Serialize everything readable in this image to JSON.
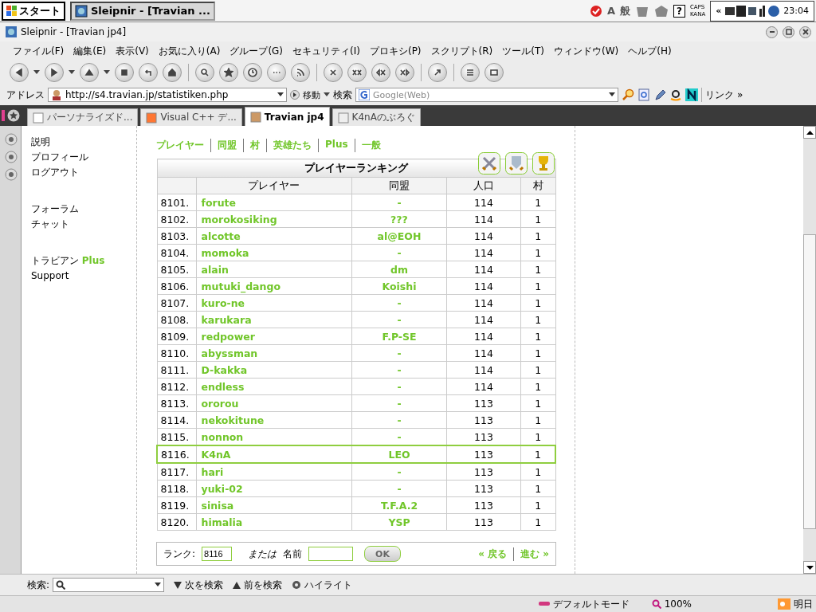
{
  "taskbar": {
    "start": "スタート",
    "tasks": [
      {
        "label": "Sleipnir - [Travian ...",
        "selected": true
      }
    ],
    "ime": [
      "A",
      "般"
    ],
    "help": "?",
    "caps": "CAPS",
    "kana": "KANA",
    "expand": "«",
    "clock": "23:04"
  },
  "window": {
    "title": "Sleipnir - [Travian jp4]"
  },
  "menu": [
    "ファイル(F)",
    "編集(E)",
    "表示(V)",
    "お気に入り(A)",
    "グループ(G)",
    "セキュリティ(I)",
    "プロキシ(P)",
    "スクリプト(R)",
    "ツール(T)",
    "ウィンドウ(W)",
    "ヘルプ(H)"
  ],
  "address_bar": {
    "label": "アドレス",
    "url": "http://s4.travian.jp/statistiken.php",
    "go": "移動",
    "search_label": "検索",
    "search_placeholder": "Google(Web)",
    "links": "リンク",
    "more": "»"
  },
  "tabs": [
    {
      "label": "パーソナライズド...",
      "selected": false
    },
    {
      "label": "Visual C++ デ...",
      "selected": false
    },
    {
      "label": "Travian jp4",
      "selected": true
    },
    {
      "label": "K4nAのぶろぐ",
      "selected": false
    }
  ],
  "sidebar": [
    [
      "説明",
      "プロフィール",
      "ログアウト"
    ],
    [
      "フォーラム",
      "チャット"
    ],
    [
      "トラビアン",
      "Support"
    ]
  ],
  "sidebar_plus": "Plus",
  "nav": [
    "プレイヤー",
    "同盟",
    "村",
    "英雄たち",
    "Plus",
    "一般"
  ],
  "table": {
    "title": "プレイヤーランキング",
    "columns": [
      "プレイヤー",
      "同盟",
      "人口",
      "村"
    ],
    "rows": [
      {
        "rank": "8101.",
        "player": "forute",
        "alliance": "-",
        "population": "114",
        "villages": "1",
        "selected": false
      },
      {
        "rank": "8102.",
        "player": "morokosiking",
        "alliance": "???",
        "population": "114",
        "villages": "1",
        "selected": false
      },
      {
        "rank": "8103.",
        "player": "alcotte",
        "alliance": "al@EOH",
        "population": "114",
        "villages": "1",
        "selected": false
      },
      {
        "rank": "8104.",
        "player": "momoka",
        "alliance": "-",
        "population": "114",
        "villages": "1",
        "selected": false
      },
      {
        "rank": "8105.",
        "player": "alain",
        "alliance": "dm",
        "population": "114",
        "villages": "1",
        "selected": false
      },
      {
        "rank": "8106.",
        "player": "mutuki_dango",
        "alliance": "Koishi",
        "population": "114",
        "villages": "1",
        "selected": false
      },
      {
        "rank": "8107.",
        "player": "kuro-ne",
        "alliance": "-",
        "population": "114",
        "villages": "1",
        "selected": false
      },
      {
        "rank": "8108.",
        "player": "karukara",
        "alliance": "-",
        "population": "114",
        "villages": "1",
        "selected": false
      },
      {
        "rank": "8109.",
        "player": "redpower",
        "alliance": "F.P-SE",
        "population": "114",
        "villages": "1",
        "selected": false
      },
      {
        "rank": "8110.",
        "player": "abyssman",
        "alliance": "-",
        "population": "114",
        "villages": "1",
        "selected": false
      },
      {
        "rank": "8111.",
        "player": "D-kakka",
        "alliance": "-",
        "population": "114",
        "villages": "1",
        "selected": false
      },
      {
        "rank": "8112.",
        "player": "endless",
        "alliance": "-",
        "population": "114",
        "villages": "1",
        "selected": false
      },
      {
        "rank": "8113.",
        "player": "ororou",
        "alliance": "-",
        "population": "113",
        "villages": "1",
        "selected": false
      },
      {
        "rank": "8114.",
        "player": "nekokitune",
        "alliance": "-",
        "population": "113",
        "villages": "1",
        "selected": false
      },
      {
        "rank": "8115.",
        "player": "nonnon",
        "alliance": "-",
        "population": "113",
        "villages": "1",
        "selected": false
      },
      {
        "rank": "8116.",
        "player": "K4nA",
        "alliance": "LEO",
        "population": "113",
        "villages": "1",
        "selected": true
      },
      {
        "rank": "8117.",
        "player": "hari",
        "alliance": "-",
        "population": "113",
        "villages": "1",
        "selected": false
      },
      {
        "rank": "8118.",
        "player": "yuki-02",
        "alliance": "-",
        "population": "113",
        "villages": "1",
        "selected": false
      },
      {
        "rank": "8119.",
        "player": "sinisa",
        "alliance": "T.F.A.2",
        "population": "113",
        "villages": "1",
        "selected": false
      },
      {
        "rank": "8120.",
        "player": "himalia",
        "alliance": "YSP",
        "population": "113",
        "villages": "1",
        "selected": false
      }
    ]
  },
  "search_form": {
    "rank_label": "ランク:",
    "rank_value": "8116",
    "or": "または",
    "name_label": "名前",
    "ok": "OK",
    "back": "« 戻る",
    "next": "進む »"
  },
  "find_bar": {
    "label": "検索:",
    "next": "次を検索",
    "prev": "前を検索",
    "highlight": "ハイライト"
  },
  "status_bar": {
    "mode": "デフォルトモード",
    "zoom": "100%",
    "weather": "明日"
  }
}
